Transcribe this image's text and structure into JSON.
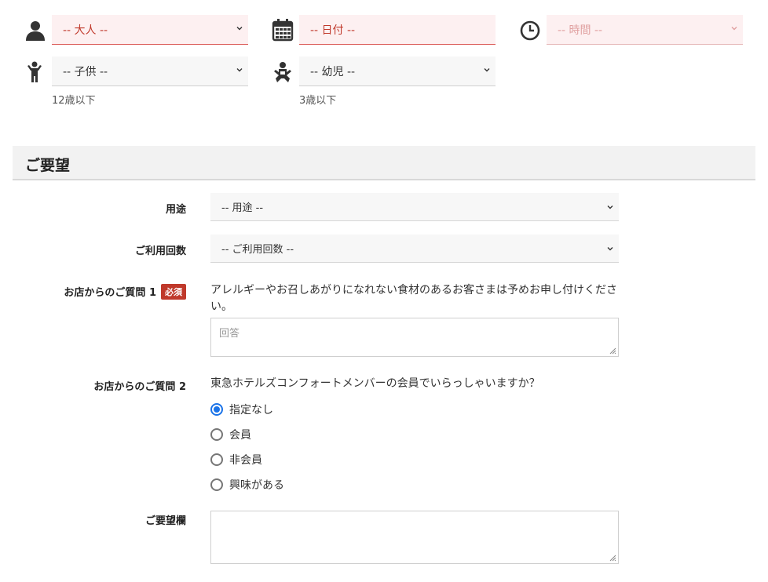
{
  "reservation": {
    "adults": {
      "value": "-- 大人 --",
      "icon": "person-icon"
    },
    "date": {
      "value": "-- 日付 --",
      "icon": "calendar-icon"
    },
    "time": {
      "value": "-- 時間 --",
      "icon": "clock-icon"
    },
    "children": {
      "value": "-- 子供 --",
      "hint": "12歳以下",
      "icon": "child-icon"
    },
    "infants": {
      "value": "-- 幼児 --",
      "hint": "3歳以下",
      "icon": "baby-icon"
    }
  },
  "requests": {
    "section_title": "ご要望",
    "purpose": {
      "label": "用途",
      "value": "-- 用途 --"
    },
    "visit_count": {
      "label": "ご利用回数",
      "value": "-- ご利用回数 --"
    },
    "question1": {
      "label": "お店からのご質問 1",
      "required_badge": "必須",
      "text": "アレルギーやお召しあがりになれない食材のあるお客さまは予めお申し付けください。",
      "placeholder": "回答"
    },
    "question2": {
      "label": "お店からのご質問 2",
      "text": "東急ホテルズコンフォートメンバーの会員でいらっしゃいますか？",
      "options": [
        "指定なし",
        "会員",
        "非会員",
        "興味がある"
      ],
      "selected": "指定なし"
    },
    "notes": {
      "label": "ご要望欄",
      "value": ""
    }
  },
  "colors": {
    "error": "#c0392b",
    "radio_selected": "#1a73e8"
  }
}
